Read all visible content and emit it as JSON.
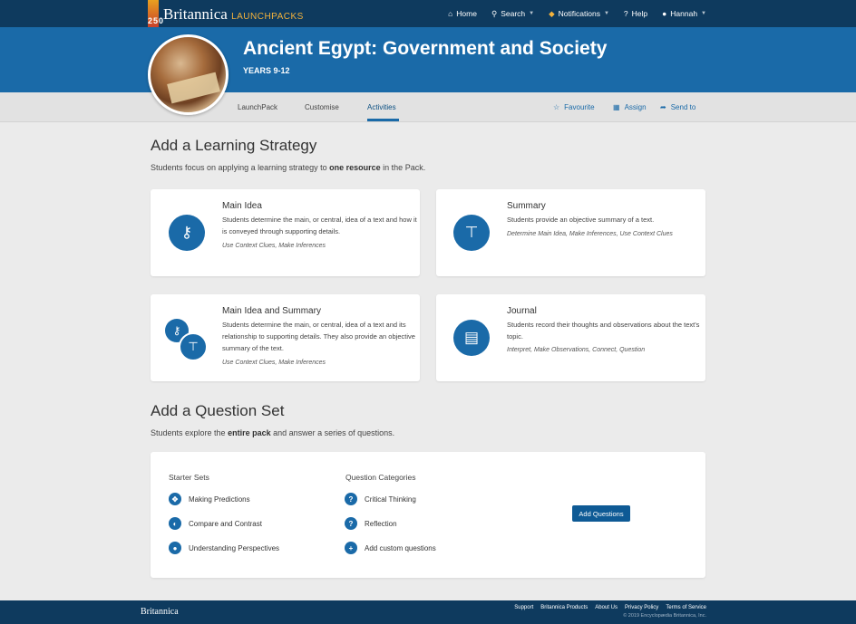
{
  "topnav": {
    "logo_number": "250",
    "brand": "Britannica",
    "product": "LAUNCHPACKS",
    "home": "Home",
    "search": "Search",
    "notifications": "Notifications",
    "help": "Help",
    "user": "Hannah"
  },
  "banner": {
    "title": "Ancient Egypt: Government and Society",
    "years": "YEARS 9-12"
  },
  "tabs": {
    "launchpack": "LaunchPack",
    "customise": "Customise",
    "activities": "Activities"
  },
  "actions": {
    "favourite": "Favourite",
    "assign": "Assign",
    "send_to": "Send to"
  },
  "strategy": {
    "heading": "Add a Learning Strategy",
    "sub_prefix": "Students focus on applying a learning strategy to ",
    "sub_bold": "one resource",
    "sub_suffix": " in the Pack.",
    "cards": [
      {
        "title": "Main Idea",
        "desc": "Students determine the main, or central, idea of a text and how it is conveyed through supporting details.",
        "tags": "Use Context Clues, Make Inferences"
      },
      {
        "title": "Summary",
        "desc": "Students provide an objective summary of a text.",
        "tags": "Determine Main Idea, Make Inferences, Use Context Clues"
      },
      {
        "title": "Main Idea and Summary",
        "desc": "Students determine the main, or central, idea of a text and its relationship to supporting details. They also provide an objective summary of the text.",
        "tags": "Use Context Clues, Make Inferences"
      },
      {
        "title": "Journal",
        "desc": "Students record their thoughts and observations about the text's topic.",
        "tags": "Interpret, Make Observations, Connect, Question"
      }
    ]
  },
  "questions": {
    "heading": "Add a Question Set",
    "sub_prefix": "Students explore the ",
    "sub_bold": "entire pack",
    "sub_suffix": " and answer a series of questions.",
    "starter_heading": "Starter Sets",
    "starter_items": [
      "Making Predictions",
      "Compare and Contrast",
      "Understanding Perspectives"
    ],
    "category_heading": "Question Categories",
    "category_items": [
      "Critical Thinking",
      "Reflection",
      "Add custom questions"
    ],
    "add_button": "Add Questions"
  },
  "footer": {
    "logo": "Britannica",
    "links": [
      "Support",
      "Britannica Products",
      "About Us",
      "Privacy Policy",
      "Terms of Service"
    ],
    "copyright": "© 2019 Encyclopædia Britannica, Inc."
  },
  "colors": {
    "nav": "#0e3a5e",
    "banner": "#1a6aa8",
    "accent": "#1a6aa8",
    "button": "#0e5a95"
  }
}
